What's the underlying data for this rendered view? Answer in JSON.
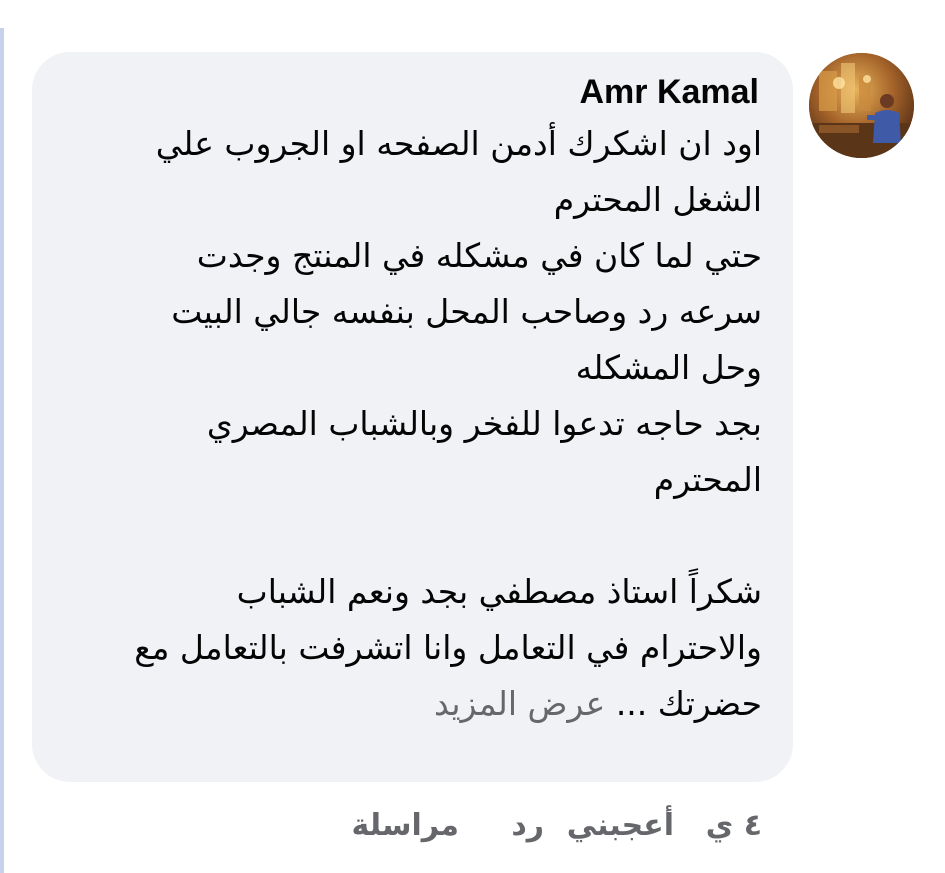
{
  "comment": {
    "author": "Amr Kamal",
    "body_lines": [
      "اود ان اشكرك أدمن الصفحه او الجروب علي",
      "الشغل المحترم",
      "حتي لما كان في مشكله في المنتج وجدت",
      "سرعه رد وصاحب المحل بنفسه جالي البيت",
      "وحل المشكله",
      "بجد حاجه تدعوا للفخر وبالشباب المصري",
      "المحترم",
      "",
      "شكراً استاذ مصطفي بجد ونعم الشباب",
      "والاحترام في التعامل وانا اتشرفت بالتعامل مع"
    ],
    "last_line_text": "حضرتك ...",
    "see_more_label": "عرض المزيد"
  },
  "actions": {
    "timestamp": "٤ ي",
    "like_label": "أعجبني",
    "reply_label": "رد",
    "message_label": "مراسلة"
  },
  "colors": {
    "bubble": "#f0f2f5",
    "text": "#050505",
    "secondary": "#65676b",
    "left_rule": "#c6d2ec"
  }
}
